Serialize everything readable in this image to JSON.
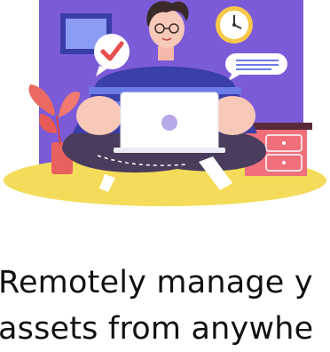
{
  "onboarding": {
    "headline_line1": "Remotely manage y",
    "headline_line2": "assets from anywhe"
  },
  "colors": {
    "wall": "#7b5bd8",
    "floor_shadow": "#f4dc5a",
    "shirt_stripe_dark": "#3b3fa8",
    "shirt_stripe_light": "#6b7be8",
    "pants": "#4a3c5c",
    "skin": "#f8c8b8",
    "hair": "#3a2a2a",
    "cabinet": "#ef6f7a",
    "check_red": "#e84d4d",
    "plant": "#ea6a62"
  },
  "icons": [
    "framed-picture-icon",
    "wall-clock-icon",
    "check-bubble-icon",
    "chat-bubble-icon",
    "laptop-icon",
    "plant-icon",
    "drawer-cabinet-icon"
  ]
}
